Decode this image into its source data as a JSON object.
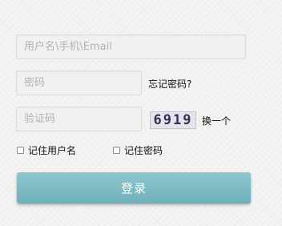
{
  "form": {
    "username_placeholder": "用户名\\手机\\Email",
    "password_placeholder": "密码",
    "forgot_password_link": "忘记密码?",
    "captcha_placeholder": "验证码",
    "captcha_code": "6919",
    "refresh_captcha_link": "换一个",
    "remember_username_label": "记住用户名",
    "remember_password_label": "记住密码",
    "login_button": "登录"
  },
  "colors": {
    "accent": "#7bbac3",
    "page_background": "#f2f2f2",
    "input_background": "#f1f1f1"
  }
}
